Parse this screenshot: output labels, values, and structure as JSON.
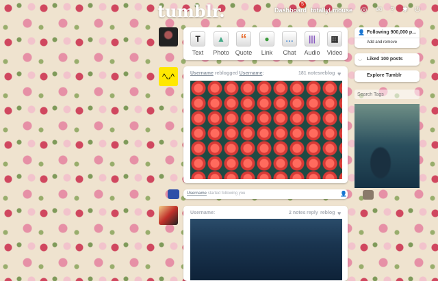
{
  "header": {
    "logo": "tumblr.",
    "dashboard": "Dashboard",
    "dashboard_badge": "5",
    "username": "totallyLmouse",
    "icons": [
      "compass-icon",
      "mail-icon",
      "help-icon",
      "gear-icon",
      "power-icon"
    ]
  },
  "composer": {
    "types": [
      {
        "label": "Text",
        "glyph": "T",
        "color": "#222"
      },
      {
        "label": "Photo",
        "glyph": "▲",
        "color": "#4a8"
      },
      {
        "label": "Quote",
        "glyph": "“",
        "color": "#e8692a"
      },
      {
        "label": "Link",
        "glyph": "●",
        "color": "#3a9a3a"
      },
      {
        "label": "Chat",
        "glyph": "…",
        "color": "#4a8ad0"
      },
      {
        "label": "Audio",
        "glyph": "|||",
        "color": "#8a5ac0"
      },
      {
        "label": "Video",
        "glyph": "▦",
        "color": "#333"
      }
    ]
  },
  "posts": [
    {
      "user": "Username",
      "action": "reblogged",
      "source": "Username",
      "colon": ":",
      "notes": "181 notes",
      "reblog": "reblog"
    },
    {
      "user": "Username:",
      "notes": "2 notes",
      "reply": "reply",
      "reblog": "reblog"
    }
  ],
  "follow_notice": {
    "user": "Username",
    "text": "started following you"
  },
  "sidebar": {
    "following": "Following 900,000 p...",
    "add_remove": "Add and remove",
    "liked": "Liked 100 posts",
    "explore": "Explore Tumblr",
    "search_placeholder": "Search Tags"
  }
}
